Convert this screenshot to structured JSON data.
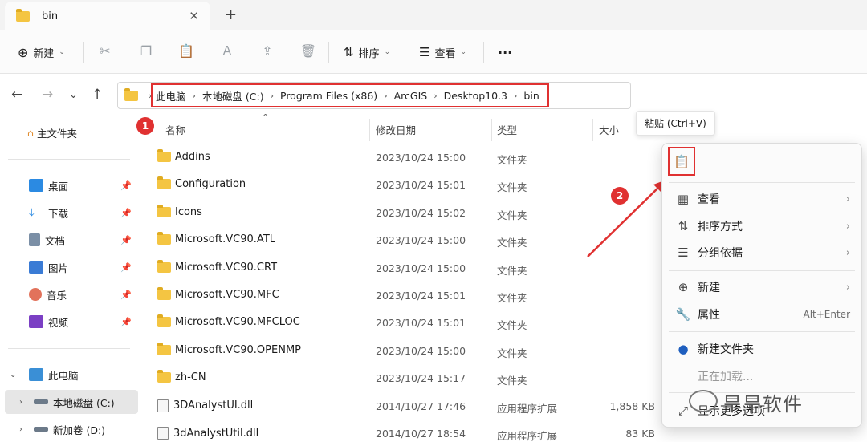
{
  "tab": {
    "title": "bin",
    "close": "✕",
    "new": "+"
  },
  "toolbar": {
    "new_label": "新建",
    "sort_label": "排序",
    "view_label": "查看",
    "more": "···"
  },
  "address": {
    "crumbs": [
      "此电脑",
      "本地磁盘 (C:)",
      "Program Files (x86)",
      "ArcGIS",
      "Desktop10.3",
      "bin"
    ]
  },
  "sidebar": {
    "home": "主文件夹",
    "pinned": [
      {
        "label": "桌面",
        "color": "#2b8ae2"
      },
      {
        "label": "下载",
        "color": "#2b8ae2"
      },
      {
        "label": "文档",
        "color": "#7b8fa6"
      },
      {
        "label": "图片",
        "color": "#3a7bd5"
      },
      {
        "label": "音乐",
        "color": "#e2725b"
      },
      {
        "label": "视频",
        "color": "#7b3fc4"
      }
    ],
    "this_pc": "此电脑",
    "drives": [
      "本地磁盘 (C:)",
      "新加卷 (D:)"
    ]
  },
  "columns": {
    "name": "名称",
    "date": "修改日期",
    "type": "类型",
    "size": "大小"
  },
  "files": [
    {
      "name": "Addins",
      "date": "2023/10/24 15:00",
      "type": "文件夹",
      "size": "",
      "kind": "folder"
    },
    {
      "name": "Configuration",
      "date": "2023/10/24 15:01",
      "type": "文件夹",
      "size": "",
      "kind": "folder"
    },
    {
      "name": "Icons",
      "date": "2023/10/24 15:02",
      "type": "文件夹",
      "size": "",
      "kind": "folder"
    },
    {
      "name": "Microsoft.VC90.ATL",
      "date": "2023/10/24 15:00",
      "type": "文件夹",
      "size": "",
      "kind": "folder"
    },
    {
      "name": "Microsoft.VC90.CRT",
      "date": "2023/10/24 15:00",
      "type": "文件夹",
      "size": "",
      "kind": "folder"
    },
    {
      "name": "Microsoft.VC90.MFC",
      "date": "2023/10/24 15:01",
      "type": "文件夹",
      "size": "",
      "kind": "folder"
    },
    {
      "name": "Microsoft.VC90.MFCLOC",
      "date": "2023/10/24 15:01",
      "type": "文件夹",
      "size": "",
      "kind": "folder"
    },
    {
      "name": "Microsoft.VC90.OPENMP",
      "date": "2023/10/24 15:00",
      "type": "文件夹",
      "size": "",
      "kind": "folder"
    },
    {
      "name": "zh-CN",
      "date": "2023/10/24 15:17",
      "type": "文件夹",
      "size": "",
      "kind": "folder"
    },
    {
      "name": "3DAnalystUI.dll",
      "date": "2014/10/27 17:46",
      "type": "应用程序扩展",
      "size": "1,858 KB",
      "kind": "dll"
    },
    {
      "name": "3dAnalystUtil.dll",
      "date": "2014/10/27 18:54",
      "type": "应用程序扩展",
      "size": "83 KB",
      "kind": "dll"
    }
  ],
  "badges": {
    "one": "1",
    "two": "2"
  },
  "tooltip": "粘贴 (Ctrl+V)",
  "context_menu": {
    "view": "查看",
    "sort": "排序方式",
    "group": "分组依据",
    "new": "新建",
    "properties": "属性",
    "properties_shortcut": "Alt+Enter",
    "new_folder": "新建文件夹",
    "loading": "正在加载...",
    "more_options": "显示更多选项"
  },
  "watermark": "旱旱软件",
  "colors": {
    "accent_red": "#e03131",
    "folder": "#f4c542"
  }
}
